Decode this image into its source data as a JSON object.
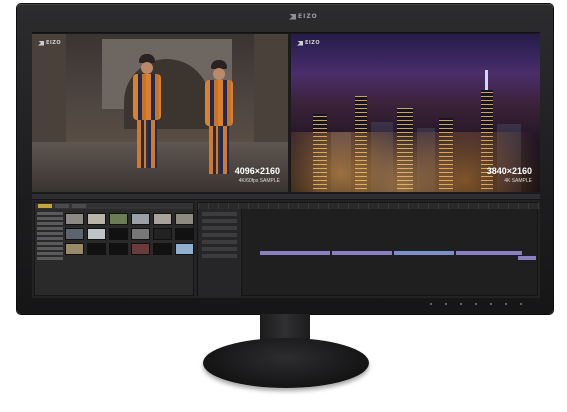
{
  "monitor": {
    "brand": "EIZO"
  },
  "left_video": {
    "logo": "EIZO",
    "resolution": "4096×2160",
    "caption": "4K/60fps SAMPLE"
  },
  "right_video": {
    "logo": "EIZO",
    "resolution": "3840×2160",
    "caption": "4K SAMPLE"
  }
}
